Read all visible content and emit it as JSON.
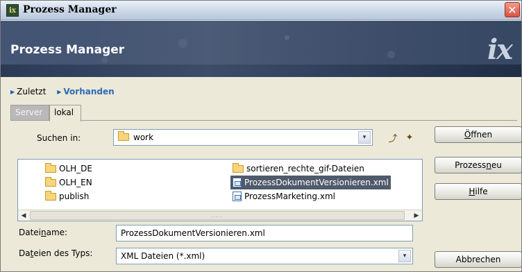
{
  "window": {
    "title": "Prozess Manager",
    "close_glyph": "✕",
    "app_icon_text": "ix"
  },
  "banner": {
    "product_name": "Prozess Manager",
    "logo_text": "ix"
  },
  "nav": {
    "links": [
      {
        "label": "Zuletzt"
      },
      {
        "label": "Vorhanden"
      }
    ]
  },
  "tabs": [
    {
      "label": "Server"
    },
    {
      "label": "lokal"
    }
  ],
  "search": {
    "label": "Suchen in:",
    "value": "work",
    "dropdown_glyph": "▾"
  },
  "toolbar": {
    "up_folder_glyph": "⤴",
    "new_folder_glyph": "✦"
  },
  "files": {
    "items": [
      {
        "name": "OLH_DE",
        "icon": "folder-icon"
      },
      {
        "name": "OLH_EN",
        "icon": "folder-icon"
      },
      {
        "name": "publish",
        "icon": "folder-icon"
      },
      {
        "name": "sortieren_rechte_gif-Dateien",
        "icon": "folder-icon"
      },
      {
        "name": "ProzessDokumentVersionieren.xml",
        "icon": "xml-file-icon",
        "selected": true
      },
      {
        "name": "ProzessMarketing.xml",
        "icon": "xml-file-icon"
      }
    ],
    "scroll_left": "◀",
    "scroll_right": "▶",
    "thumb_grip": "....."
  },
  "filename": {
    "label": "Dateiname:",
    "value": "ProzessDokumentVersionieren.xml"
  },
  "filetype": {
    "label": "Dateien des Typs:",
    "value": "XML Dateien (*.xml)",
    "dropdown_glyph": "▾"
  },
  "buttons": {
    "open": "Öffnen",
    "new_process": "Prozess neu",
    "help": "Hilfe",
    "cancel": "Abbrechen"
  }
}
